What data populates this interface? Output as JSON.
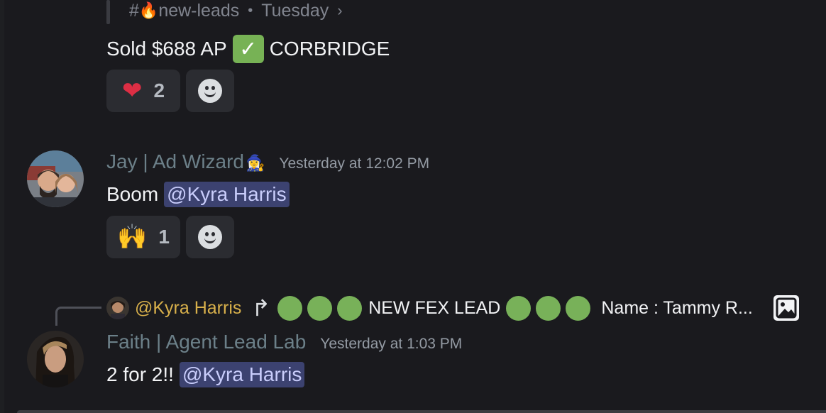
{
  "context_header": {
    "channel": "new-leads",
    "day": "Tuesday"
  },
  "messages": [
    {
      "text_before": "Sold $688 AP",
      "text_after": "CORBRIDGE",
      "reactions": [
        {
          "emoji": "❤️",
          "count": "2"
        }
      ]
    },
    {
      "author": "Jay | Ad Wizard",
      "author_badge": "🧙‍♀️",
      "timestamp": "Yesterday at 12:02 PM",
      "text": "Boom",
      "mention": "@Kyra Harris",
      "reactions": [
        {
          "emoji": "🙌",
          "count": "1"
        }
      ]
    },
    {
      "reply_to": {
        "mention": "@Kyra Harris",
        "text_mid": "NEW FEX LEAD",
        "text_end": "Name : Tammy R..."
      },
      "author": "Faith | Agent Lead Lab",
      "timestamp": "Yesterday at 1:03 PM",
      "text": "2 for 2!!",
      "mention": "@Kyra Harris"
    }
  ],
  "icons": {
    "add_reaction": "smile-face-icon",
    "reply": "reply-arrow-icon",
    "attachment": "image-icon"
  },
  "colors": {
    "background": "#1a1a1e",
    "mention_bg": "#3c4270",
    "green_circle": "#78b159",
    "reply_mention": "#d8b04b"
  }
}
